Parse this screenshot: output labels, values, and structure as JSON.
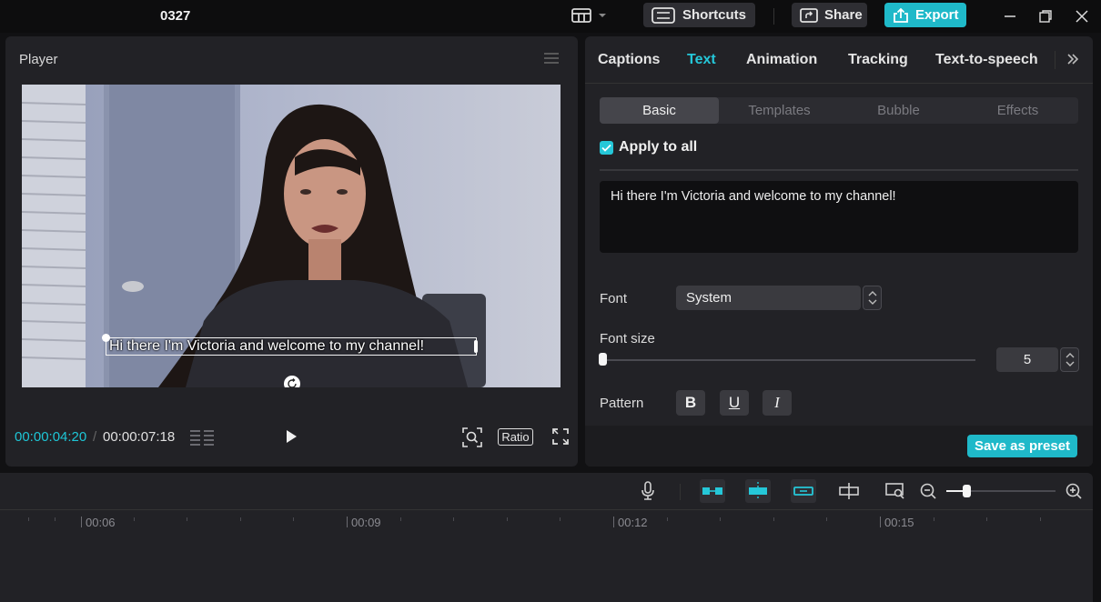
{
  "app": {
    "title": "0327"
  },
  "titlebar": {
    "shortcuts_label": "Shortcuts",
    "share_label": "Share",
    "export_label": "Export"
  },
  "player": {
    "title": "Player",
    "caption_text": "Hi there I'm Victoria and welcome to my channel!",
    "current_time": "00:00:04:20",
    "separator": "/",
    "total_time": "00:00:07:18",
    "ratio_label": "Ratio"
  },
  "panel": {
    "tabs": [
      {
        "label": "Captions"
      },
      {
        "label": "Text"
      },
      {
        "label": "Animation"
      },
      {
        "label": "Tracking"
      },
      {
        "label": "Text-to-speech"
      }
    ],
    "active_tab": "Text",
    "subtabs": [
      {
        "label": "Basic"
      },
      {
        "label": "Templates"
      },
      {
        "label": "Bubble"
      },
      {
        "label": "Effects"
      }
    ],
    "apply_to_all_label": "Apply to all",
    "apply_to_all_checked": true,
    "text_value": "Hi there I'm Victoria and welcome to my channel!",
    "font_label": "Font",
    "font_value": "System",
    "font_size_label": "Font size",
    "font_size_value": "5",
    "pattern_label": "Pattern",
    "pattern_buttons": [
      "B",
      "U",
      "I"
    ],
    "save_preset_label": "Save as preset"
  },
  "timeline": {
    "ruler_labels": [
      "00:06",
      "00:09",
      "00:12",
      "00:15"
    ],
    "zoom_level": 0.18
  },
  "colors": {
    "accent": "#25c7d8",
    "export_bg": "#1fb9c9",
    "panel_bg": "#222226",
    "app_bg": "#111113"
  }
}
